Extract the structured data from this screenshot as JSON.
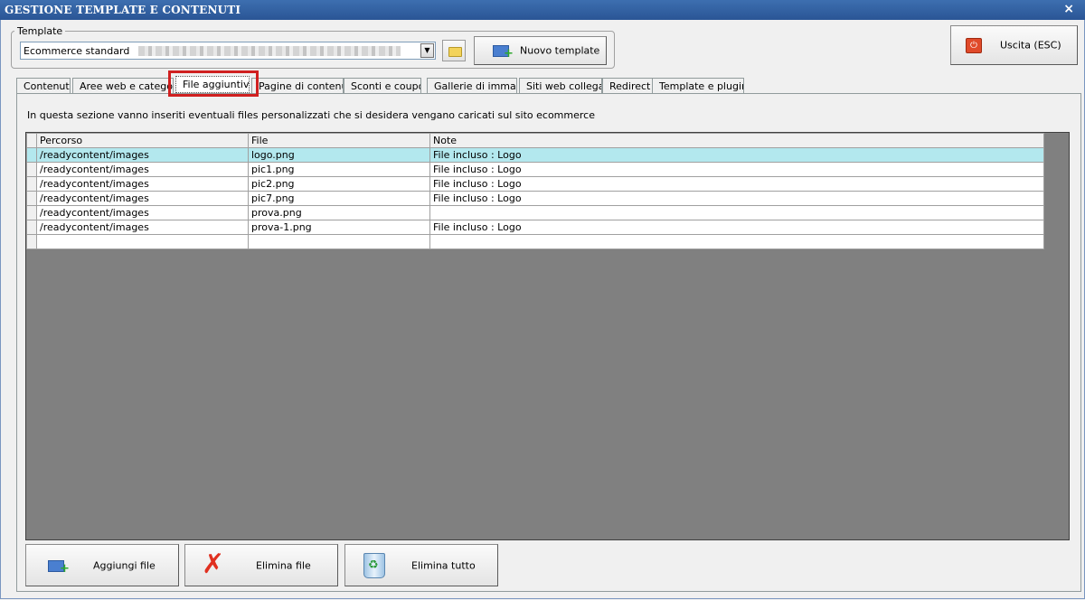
{
  "window": {
    "title": "GESTIONE TEMPLATE E CONTENUTI",
    "close_glyph": "×"
  },
  "template_group": {
    "label": "Template",
    "selected": "Ecommerce standard"
  },
  "buttons": {
    "nuovo_template": "Nuovo template",
    "uscita": "Uscita (ESC)"
  },
  "tabs": [
    "Contenuti",
    "Aree web e categorie",
    "File aggiuntivi",
    "Pagine di contenuti",
    "Sconti e coupon",
    "Gallerie di immagini",
    "Siti web collegati",
    "Redirect",
    "Template e plugins"
  ],
  "active_tab": "File aggiuntivi",
  "info_text": "In questa sezione vanno inseriti eventuali files personalizzati che si desidera vengano caricati sul sito ecommerce",
  "table": {
    "columns": [
      "Percorso",
      "File",
      "Note"
    ],
    "rows": [
      [
        "/readycontent/images",
        "logo.png",
        "File incluso : Logo"
      ],
      [
        "/readycontent/images",
        "pic1.png",
        "File incluso : Logo"
      ],
      [
        "/readycontent/images",
        "pic2.png",
        "File incluso : Logo"
      ],
      [
        "/readycontent/images",
        "pic7.png",
        "File incluso : Logo"
      ],
      [
        "/readycontent/images",
        "prova.png",
        ""
      ],
      [
        "/readycontent/images",
        "prova-1.png",
        "File incluso : Logo"
      ]
    ],
    "selected_row": 0
  },
  "actions": {
    "aggiungi": "Aggiungi file",
    "elimina": "Elimina file",
    "elimina_tutto": "Elimina tutto"
  },
  "colors": {
    "title_bar": "#2a5595",
    "selected_row": "#b3e8ee",
    "highlight": "#d02020"
  }
}
